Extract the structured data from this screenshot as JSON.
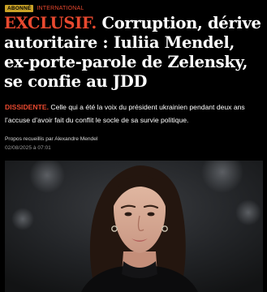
{
  "tags": {
    "badge": "ABONNÉ",
    "category": "INTERNATIONAL"
  },
  "headline": {
    "kicker": "EXCLUSIF.",
    "text": "Corruption, dérive autoritaire : Iuliia Mendel, ex-porte-parole de Zelensky, se confie au JDD"
  },
  "lede": {
    "lead": "DISSIDENTE.",
    "text": "Celle qui a été la voix du président ukrainien pendant deux ans l’accuse d’avoir fait du conflit le socle de sa survie politique."
  },
  "byline": "Propos recueillis par Alexandre Mendel",
  "timestamp": "02/08/2025 à 07:01",
  "colors": {
    "accent": "#e8492f",
    "badge": "#c9a227",
    "background": "#000000"
  }
}
